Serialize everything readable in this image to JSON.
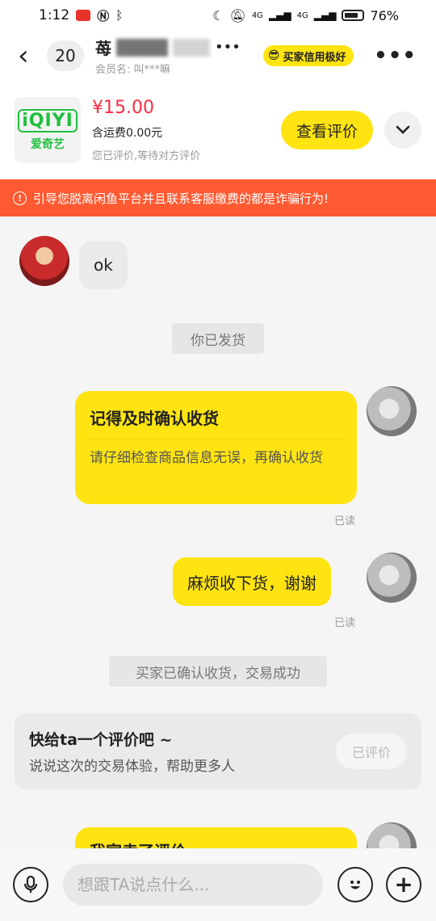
{
  "status_bar": {
    "time": "1:12",
    "network_1": "4G",
    "network_2": "4G",
    "battery_percent": "76%",
    "battery_level": 0.76
  },
  "header": {
    "unread_count": "20",
    "name_visible": "苺",
    "member_label": "会员名: 叫***嘛",
    "buyer_badge": "买家信用极好",
    "more": "•••"
  },
  "product": {
    "thumb_logo": "iQIYI",
    "thumb_text": "爱奇艺",
    "price": "¥15.00",
    "shipping": "含运费0.00元",
    "review_status": "您已评价,等待对方评价",
    "view_review_label": "查看评价"
  },
  "warning": {
    "text": "引导您脱离闲鱼平台并且联系客服缴费的都是诈骗行为!"
  },
  "chat": {
    "msg_ok": "ok",
    "system_shipped": "你已发货",
    "card_title": "记得及时确认收货",
    "card_body": "请仔细检查商品信息无误，再确认收货",
    "read_1": "已读",
    "msg_thanks": "麻烦收下货，谢谢",
    "read_2": "已读",
    "system_confirmed": "买家已确认收货，交易成功",
    "review_title": "快给ta一个评价吧 ~",
    "review_sub": "说说这次的交易体验，帮助更多人",
    "reviewed_label": "已评价",
    "partial_card_title": "我家卖了评价"
  },
  "input_bar": {
    "placeholder": "想跟TA说点什么..."
  },
  "colors": {
    "accent_yellow": "#ffe411",
    "warning_orange": "#ff5a32",
    "price_red": "#ff2a45",
    "iqiyi_green": "#1fbf3d"
  },
  "icons": [
    "back-icon",
    "mic-icon",
    "emoji-icon",
    "plus-icon",
    "chevron-down-icon",
    "warning-icon",
    "moon-icon",
    "mute-icon",
    "bluetooth-icon",
    "nfc-icon",
    "battery-icon"
  ]
}
